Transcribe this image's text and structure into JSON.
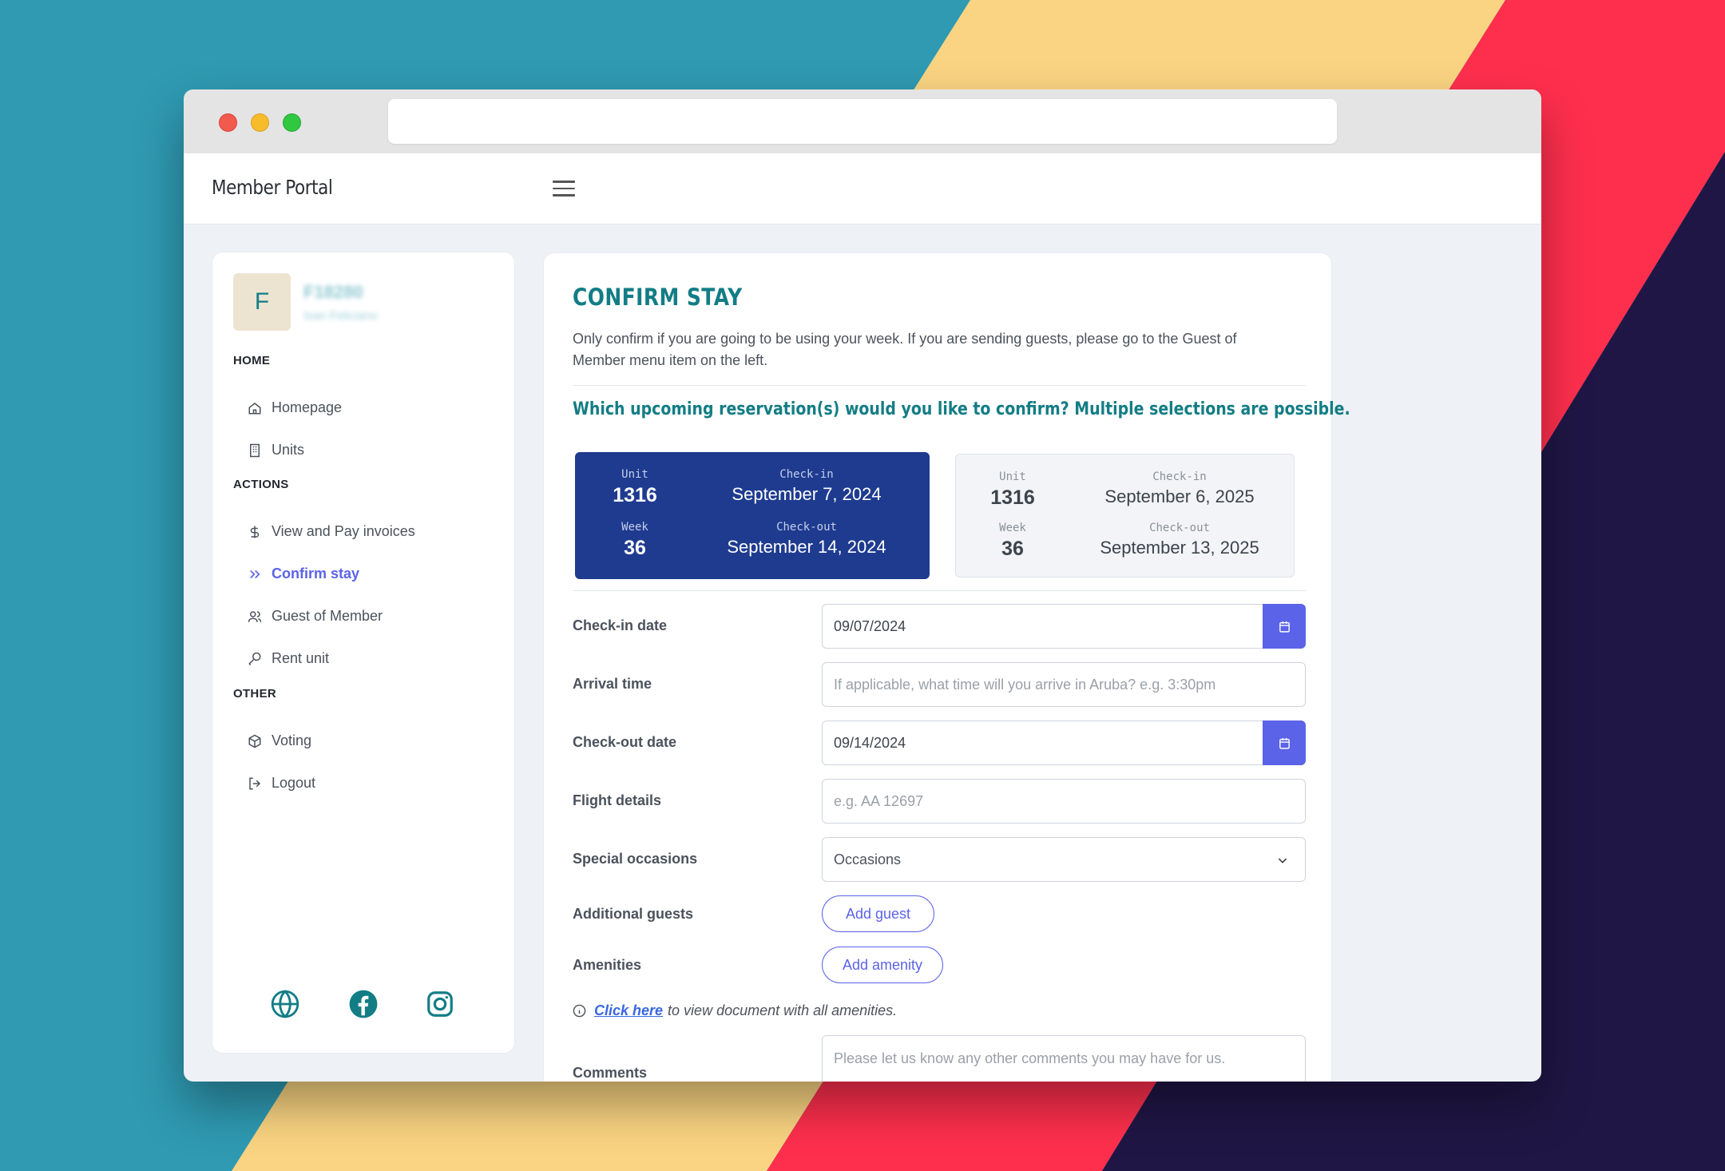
{
  "app": {
    "brand": "Member Portal"
  },
  "profile": {
    "initial": "F",
    "id": "F18280",
    "name": "Ivan Feliciano"
  },
  "sidebar": {
    "sections": {
      "home": "HOME",
      "actions": "ACTIONS",
      "other": "OTHER"
    },
    "items": [
      {
        "label": "Homepage",
        "icon": "home-icon"
      },
      {
        "label": "Units",
        "icon": "building-icon"
      },
      {
        "label": "View and Pay invoices",
        "icon": "dollar-icon"
      },
      {
        "label": "Confirm stay",
        "icon": "double-chevron-right-icon",
        "active": true
      },
      {
        "label": "Guest of Member",
        "icon": "users-icon"
      },
      {
        "label": "Rent unit",
        "icon": "key-icon"
      },
      {
        "label": "Voting",
        "icon": "cube-icon"
      },
      {
        "label": "Logout",
        "icon": "logout-icon"
      }
    ],
    "social": [
      "globe-icon",
      "facebook-icon",
      "instagram-icon"
    ]
  },
  "main": {
    "title": "CONFIRM STAY",
    "intro": "Only confirm if you are going to be using your week. If you are sending guests, please go to the Guest of Member menu item on the left.",
    "question": "Which upcoming reservation(s) would you like to confirm? Multiple selections are possible.",
    "reservations": [
      {
        "unit_label": "Unit",
        "unit": "1316",
        "week_label": "Week",
        "week": "36",
        "checkin_label": "Check-in",
        "checkin": "September 7, 2024",
        "checkout_label": "Check-out",
        "checkout": "September 14, 2024",
        "selected": true
      },
      {
        "unit_label": "Unit",
        "unit": "1316",
        "week_label": "Week",
        "week": "36",
        "checkin_label": "Check-in",
        "checkin": "September 6, 2025",
        "checkout_label": "Check-out",
        "checkout": "September 13, 2025",
        "selected": false
      }
    ],
    "form": {
      "checkin_label": "Check-in date",
      "checkin_value": "09/07/2024",
      "arrival_label": "Arrival time",
      "arrival_placeholder": "If applicable, what time will you arrive in Aruba? e.g. 3:30pm",
      "checkout_label": "Check-out date",
      "checkout_value": "09/14/2024",
      "flight_label": "Flight details",
      "flight_placeholder": "e.g. AA 12697",
      "occasions_label": "Special occasions",
      "occasions_value": "Occasions",
      "guests_label": "Additional guests",
      "add_guest": "Add guest",
      "amenities_label": "Amenities",
      "add_amenity": "Add amenity",
      "note_link": "Click here",
      "note_text": "to view document with all amenities.",
      "comments_label": "Comments",
      "comments_placeholder": "Please let us know any other comments you may have for us."
    }
  },
  "colors": {
    "accent": "#5b63e8",
    "brand": "#137d85",
    "selected_card": "#1e3b8f"
  }
}
